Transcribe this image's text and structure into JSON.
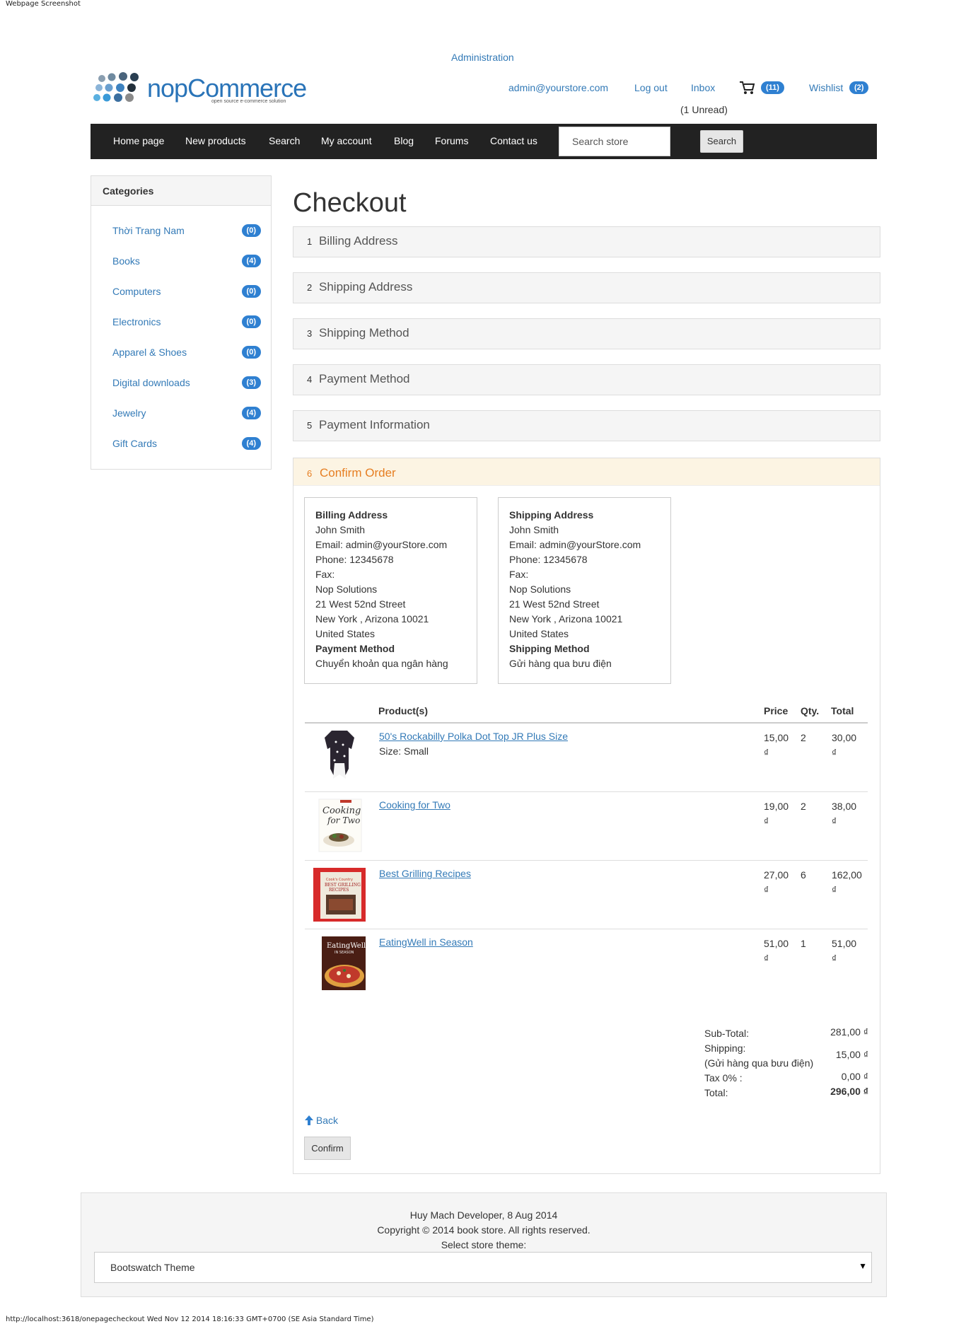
{
  "caption_top": "Webpage Screenshot",
  "caption_bottom": "http://localhost:3618/onepagecheckout Wed Nov 12 2014 18:16:33 GMT+0700 (SE Asia Standard Time)",
  "header": {
    "admin_link": "Administration",
    "email": "admin@yourstore.com",
    "logout": "Log out",
    "inbox": "Inbox",
    "unread": "(1 Unread)",
    "cart_count": "(11)",
    "wishlist": "Wishlist",
    "wishlist_count": "(2)",
    "logo_text": "nopCommerce",
    "logo_tagline": "open source e-commerce solution"
  },
  "nav": {
    "items": [
      "Home page",
      "New products",
      "Search",
      "My account",
      "Blog",
      "Forums",
      "Contact us"
    ],
    "search_placeholder": "Search store",
    "search_button": "Search"
  },
  "sidebar": {
    "title": "Categories",
    "items": [
      {
        "label": "Thời Trang Nam",
        "count": "(0)"
      },
      {
        "label": "Books",
        "count": "(4)"
      },
      {
        "label": "Computers",
        "count": "(0)"
      },
      {
        "label": "Electronics",
        "count": "(0)"
      },
      {
        "label": "Apparel & Shoes",
        "count": "(0)"
      },
      {
        "label": "Digital downloads",
        "count": "(3)"
      },
      {
        "label": "Jewelry",
        "count": "(4)"
      },
      {
        "label": "Gift Cards",
        "count": "(4)"
      }
    ]
  },
  "checkout": {
    "title": "Checkout",
    "steps": [
      {
        "num": "1",
        "label": "Billing Address"
      },
      {
        "num": "2",
        "label": "Shipping Address"
      },
      {
        "num": "3",
        "label": "Shipping Method"
      },
      {
        "num": "4",
        "label": "Payment Method"
      },
      {
        "num": "5",
        "label": "Payment Information"
      }
    ],
    "active_step": {
      "num": "6",
      "label": "Confirm Order"
    },
    "billing": {
      "title": "Billing Address",
      "lines": [
        "John Smith",
        "Email: admin@yourStore.com",
        "Phone: 12345678",
        "Fax:",
        "Nop Solutions",
        "21 West 52nd Street",
        "New York , Arizona 10021",
        "United States"
      ],
      "method_title": "Payment Method",
      "method": "Chuyển khoản qua ngân hàng"
    },
    "shipping": {
      "title": "Shipping Address",
      "lines": [
        "John Smith",
        "Email: admin@yourStore.com",
        "Phone: 12345678",
        "Fax:",
        "Nop Solutions",
        "21 West 52nd Street",
        "New York , Arizona 10021",
        "United States"
      ],
      "method_title": "Shipping Method",
      "method": "Gửi hàng qua bưu điện"
    },
    "table": {
      "headers": {
        "product": "Product(s)",
        "price": "Price",
        "qty": "Qty.",
        "total": "Total"
      },
      "rows": [
        {
          "name": "50's Rockabilly Polka Dot Top JR Plus Size",
          "attr": "Size: Small",
          "price": "15,00",
          "qty": "2",
          "total": "30,00",
          "cur": "₫"
        },
        {
          "name": "Cooking for Two",
          "attr": "",
          "price": "19,00",
          "qty": "2",
          "total": "38,00",
          "cur": "₫"
        },
        {
          "name": "Best Grilling Recipes",
          "attr": "",
          "price": "27,00",
          "qty": "6",
          "total": "162,00",
          "cur": "₫"
        },
        {
          "name": "EatingWell in Season",
          "attr": "",
          "price": "51,00",
          "qty": "1",
          "total": "51,00",
          "cur": "₫"
        }
      ]
    },
    "totals": {
      "subtotal_label": "Sub-Total:",
      "subtotal": "281,00 ₫",
      "shipping_label": "Shipping:",
      "shipping_note": "(Gửi hàng qua bưu điện)",
      "shipping": "15,00 ₫",
      "tax_label": "Tax 0% :",
      "tax": "0,00 ₫",
      "total_label": "Total:",
      "total": "296,00 ₫"
    },
    "back": "Back",
    "confirm": "Confirm"
  },
  "footer": {
    "line1": "Huy Mach Developer, 8 Aug 2014",
    "line2": "Copyright © 2014 book store. All rights reserved.",
    "line3": "Select store theme:",
    "theme": "Bootswatch Theme"
  },
  "colors": {
    "accent": "#337ab7",
    "badge": "#2f80d1",
    "nav_bg": "#222222",
    "active_step": "#e67e22"
  }
}
